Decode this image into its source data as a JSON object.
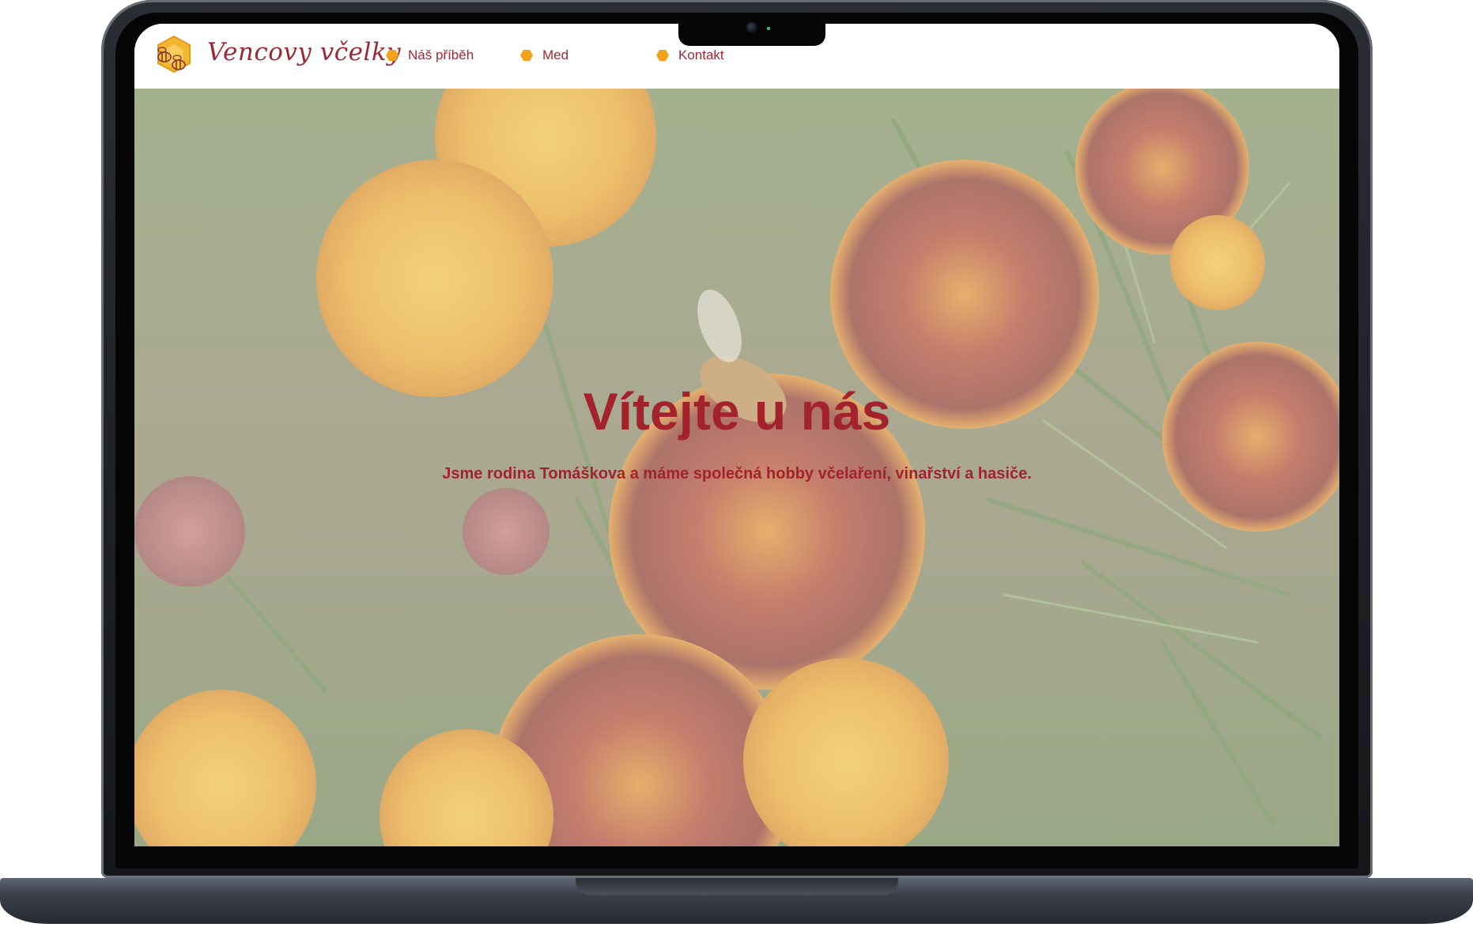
{
  "site": {
    "brand": "Vencovy včelky",
    "nav": [
      {
        "label": "Náš příběh"
      },
      {
        "label": "Med"
      },
      {
        "label": "Kontakt"
      }
    ]
  },
  "hero": {
    "title": "Vítejte u nás",
    "subtitle": "Jsme rodina Tomáškova a máme společná hobby včelaření, vinařství a hasiče."
  },
  "colors": {
    "accent": "#a3232d",
    "honey": "#f2a11d",
    "nav_bg": "#ffffff"
  },
  "icons": {
    "logo": "bee-honeycomb-logo",
    "nav_bullet": "hexagon-icon"
  }
}
